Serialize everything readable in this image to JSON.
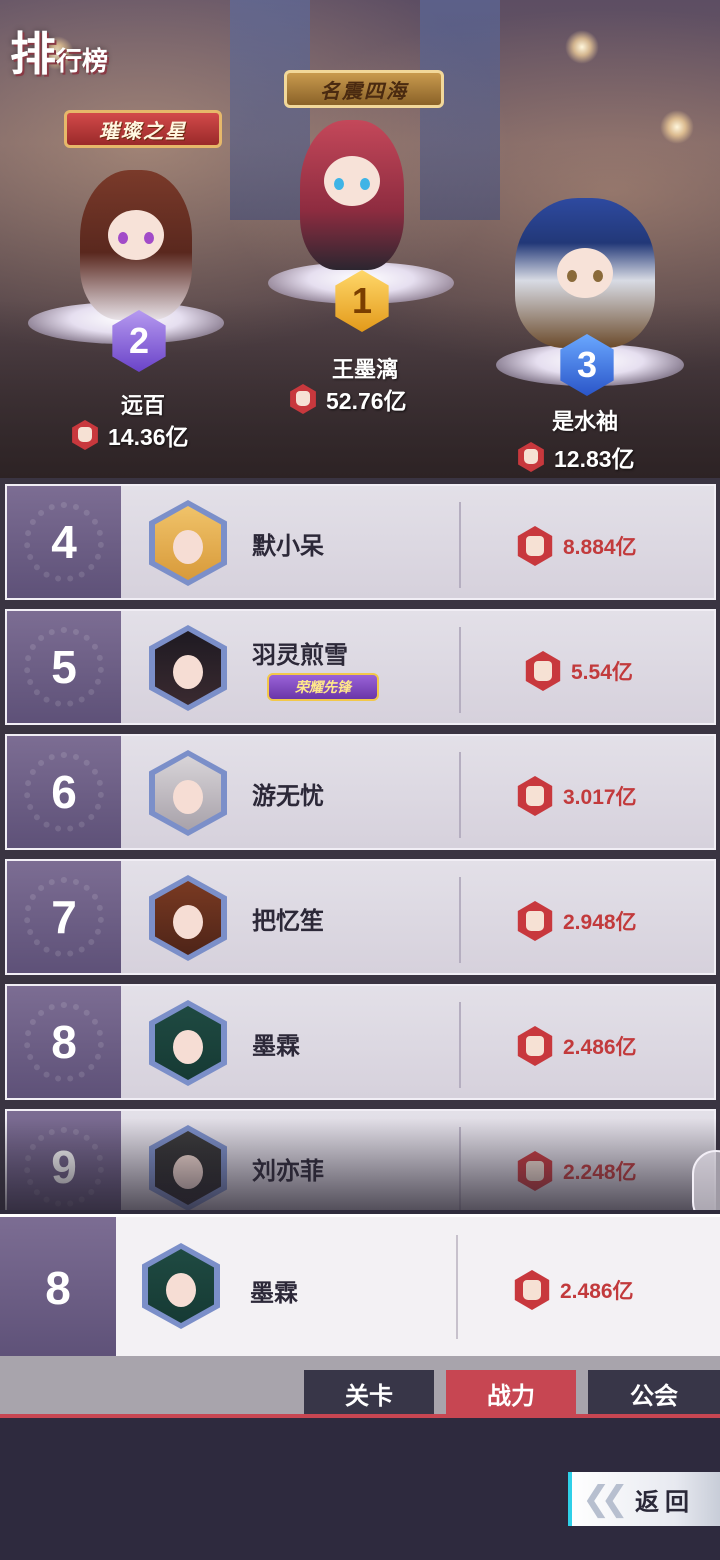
{
  "header": {
    "title_big": "排",
    "title_small": "行榜"
  },
  "podium": {
    "first": {
      "title": "名震四海",
      "rank": "1",
      "name": "王墨漓",
      "power": "52.76亿"
    },
    "second": {
      "title": "璀璨之星",
      "rank": "2",
      "name": "远百",
      "power": "14.36亿"
    },
    "third": {
      "rank": "3",
      "name": "是水袖",
      "power": "12.83亿"
    }
  },
  "list": [
    {
      "rank": "4",
      "name": "默小呆",
      "power": "8.884亿"
    },
    {
      "rank": "5",
      "name": "羽灵煎雪",
      "power": "5.54亿",
      "tag": "荣耀先锋"
    },
    {
      "rank": "6",
      "name": "游无忧",
      "power": "3.017亿"
    },
    {
      "rank": "7",
      "name": "把忆笙",
      "power": "2.948亿"
    },
    {
      "rank": "8",
      "name": "墨霖",
      "power": "2.486亿"
    },
    {
      "rank": "9",
      "name": "刘亦菲",
      "power": "2.248亿"
    }
  ],
  "my_rank": {
    "rank": "8",
    "name": "墨霖",
    "power": "2.486亿"
  },
  "tabs": [
    {
      "label": "关卡",
      "active": false
    },
    {
      "label": "战力",
      "active": true
    },
    {
      "label": "公会",
      "active": false
    }
  ],
  "back_button": {
    "label": "返回"
  },
  "colors": {
    "accent_red": "#c74652",
    "power_red": "#c23a3c",
    "rank_panel": "#6e6087",
    "back_accent": "#2fd0e8"
  },
  "icons": {
    "power": "fist-icon",
    "back": "double-chevron-left-icon"
  }
}
